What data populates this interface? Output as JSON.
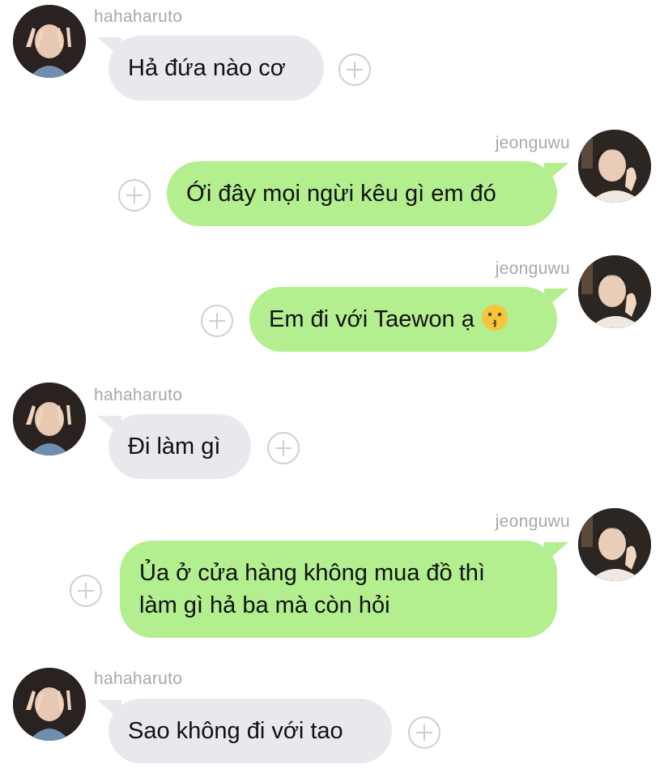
{
  "users": {
    "left": "hahaharuto",
    "right": "jeonguwu"
  },
  "messages": [
    {
      "side": "left",
      "username": "hahaharuto",
      "text": "Hả đứa nào cơ"
    },
    {
      "side": "right",
      "username": "jeonguwu",
      "text": "Ới đây mọi ngừi kêu gì em đó"
    },
    {
      "side": "right",
      "username": "jeonguwu",
      "text": "Em đi với Taewon ạ",
      "emoji": "kissing-face"
    },
    {
      "side": "left",
      "username": "hahaharuto",
      "text": "Đi làm gì"
    },
    {
      "side": "right",
      "username": "jeonguwu",
      "line1": "Ủa ở cửa hàng không mua đồ thì",
      "line2": "làm gì hả ba mà còn hỏi"
    },
    {
      "side": "left",
      "username": "hahaharuto",
      "text": "Sao không đi với tao"
    }
  ],
  "colors": {
    "left_bubble": "#e8e9ed",
    "right_bubble": "#b3ee8f",
    "username": "#a8a8a8",
    "plus_icon": "#cfcfcf"
  }
}
